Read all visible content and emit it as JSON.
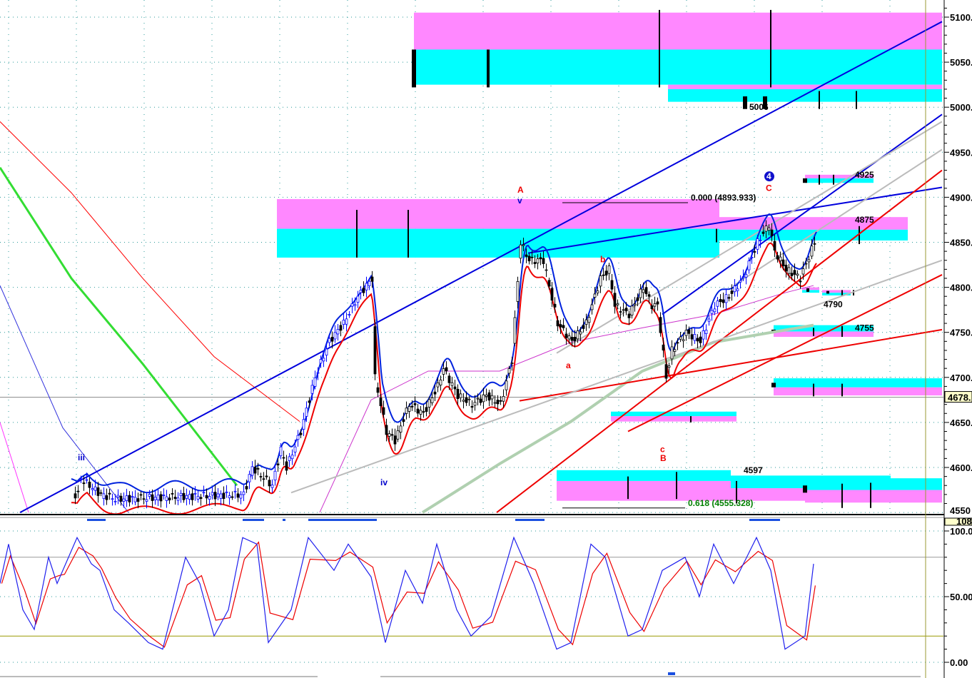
{
  "chart_data": {
    "type": "candlestick",
    "price_axis": {
      "ticks": [
        5100,
        5050,
        5000,
        4950,
        4900,
        4850,
        4800,
        4750,
        4700,
        4650,
        4600
      ],
      "tick_labels": [
        "5100.",
        "5050.",
        "5000.",
        "4950.",
        "4900.",
        "4850.",
        "4800.",
        "4750.",
        "4700.",
        "4650.",
        "4600."
      ],
      "partial_label": "4550",
      "current_price_label": "4678.",
      "current_price": 4678
    },
    "price_path": [
      [
        27,
        4590
      ],
      [
        35,
        4570
      ],
      [
        40,
        4565
      ],
      [
        85,
        4570
      ],
      [
        88,
        4600
      ],
      [
        95,
        4580
      ],
      [
        98,
        4620
      ],
      [
        100,
        4600
      ],
      [
        105,
        4640
      ],
      [
        110,
        4700
      ],
      [
        115,
        4740
      ],
      [
        120,
        4760
      ],
      [
        125,
        4790
      ],
      [
        130,
        4810
      ],
      [
        131,
        4700
      ],
      [
        135,
        4640
      ],
      [
        138,
        4630
      ],
      [
        143,
        4670
      ],
      [
        148,
        4660
      ],
      [
        153,
        4690
      ],
      [
        155,
        4710
      ],
      [
        160,
        4680
      ],
      [
        165,
        4670
      ],
      [
        170,
        4680
      ],
      [
        175,
        4670
      ],
      [
        179,
        4720
      ],
      [
        182,
        4850
      ],
      [
        185,
        4830
      ],
      [
        190,
        4830
      ],
      [
        195,
        4760
      ],
      [
        200,
        4740
      ],
      [
        205,
        4760
      ],
      [
        210,
        4810
      ],
      [
        213,
        4820
      ],
      [
        215,
        4780
      ],
      [
        220,
        4770
      ],
      [
        225,
        4800
      ],
      [
        228,
        4780
      ],
      [
        230,
        4780
      ],
      [
        233,
        4700
      ],
      [
        235,
        4730
      ],
      [
        240,
        4750
      ],
      [
        245,
        4740
      ],
      [
        250,
        4780
      ],
      [
        255,
        4790
      ],
      [
        260,
        4810
      ],
      [
        265,
        4850
      ],
      [
        269,
        4870
      ],
      [
        271,
        4840
      ],
      [
        275,
        4820
      ],
      [
        280,
        4810
      ],
      [
        285,
        4850
      ]
    ],
    "moving_averages": [
      {
        "name": "red-ma",
        "color": "#ff0000",
        "points": [
          [
            0,
            4984
          ],
          [
            25,
            4905
          ],
          [
            50,
            4810
          ],
          [
            75,
            4723
          ],
          [
            105,
            4651
          ]
        ]
      },
      {
        "name": "green-ma",
        "color": "#33dd33",
        "points": [
          [
            0,
            4933
          ],
          [
            25,
            4810
          ],
          [
            50,
            4715
          ],
          [
            83,
            4580
          ]
        ]
      },
      {
        "name": "blue-thin-ma",
        "color": "#3333dd",
        "points": [
          [
            0,
            4802
          ],
          [
            22,
            4644
          ],
          [
            45,
            4550
          ]
        ]
      },
      {
        "name": "magenta-left-ma",
        "color": "#ff33ff",
        "points": [
          [
            0,
            4650
          ],
          [
            10,
            4550
          ]
        ]
      },
      {
        "name": "gray-green-ma",
        "color": "#b0d0b0",
        "points": [
          [
            148,
            4550
          ],
          [
            175,
            4604
          ],
          [
            200,
            4651
          ],
          [
            225,
            4707
          ],
          [
            250,
            4739
          ],
          [
            285,
            4758
          ]
        ]
      },
      {
        "name": "magenta-ma",
        "color": "#cc33cc",
        "points": [
          [
            112,
            4550
          ],
          [
            130,
            4675
          ],
          [
            150,
            4707
          ],
          [
            175,
            4707
          ],
          [
            200,
            4739
          ],
          [
            225,
            4755
          ],
          [
            250,
            4770
          ],
          [
            275,
            4794
          ],
          [
            285,
            4802
          ]
        ]
      }
    ],
    "trendlines": [
      {
        "color": "#0000dd",
        "from": [
          7,
          4550
        ],
        "to": [
          330,
          5095
        ]
      },
      {
        "color": "#0000dd",
        "from": [
          185,
          4838
        ],
        "to": [
          330,
          4911
        ]
      },
      {
        "color": "#0000dd",
        "from": [
          232,
          4770
        ],
        "to": [
          330,
          4992
        ]
      },
      {
        "color": "#ee0000",
        "from": [
          174,
          4550
        ],
        "to": [
          330,
          4930
        ]
      },
      {
        "color": "#ee0000",
        "from": [
          182,
          4674
        ],
        "to": [
          330,
          4753
        ]
      },
      {
        "color": "#ee0000",
        "from": [
          220,
          4640
        ],
        "to": [
          330,
          4814
        ]
      },
      {
        "color": "#bbbbbb",
        "from": [
          102,
          4572
        ],
        "to": [
          330,
          4830
        ]
      },
      {
        "color": "#bbbbbb",
        "from": [
          195,
          4727
        ],
        "to": [
          330,
          4984
        ]
      },
      {
        "color": "#bbbbbb",
        "from": [
          257,
          4802
        ],
        "to": [
          330,
          4953
        ]
      }
    ],
    "zones": [
      {
        "from": 145,
        "to": 330,
        "pink": [
          5105,
          5064
        ],
        "cyan": [
          5064,
          5025
        ]
      },
      {
        "from": 234,
        "to": 330,
        "pink": [
          5025,
          5020
        ],
        "cyan": [
          5020,
          5006
        ]
      },
      {
        "from": 97,
        "to": 252,
        "pink": [
          4898,
          4865
        ],
        "cyan": [
          4865,
          4833
        ]
      },
      {
        "from": 252,
        "to": 318,
        "pink": [
          4878,
          4864
        ],
        "cyan": [
          4864,
          4852
        ]
      },
      {
        "from": 282,
        "to": 306,
        "pink": [
          4925,
          4921
        ],
        "cyan": [
          4921,
          4916
        ]
      },
      {
        "from": 281,
        "to": 287,
        "pink": [
          4800,
          4797
        ],
        "cyan": [
          4797,
          4794
        ]
      },
      {
        "from": 288,
        "to": 298,
        "pink": [
          4797,
          4794
        ],
        "cyan": [
          4794,
          4791
        ]
      },
      {
        "from": 271,
        "to": 306,
        "cyan": [
          4758,
          4751
        ],
        "pink": [
          4751,
          4745
        ]
      },
      {
        "from": 271,
        "to": 330,
        "cyan": [
          4699,
          4689
        ],
        "pink": [
          4689,
          4680
        ]
      },
      {
        "from": 214,
        "to": 258,
        "cyan": [
          4662,
          4657
        ],
        "pink": [
          4657,
          4651
        ]
      },
      {
        "from": 195,
        "to": 256,
        "cyan": [
          4597,
          4585
        ],
        "pink": [
          4585,
          4563
        ]
      },
      {
        "from": 256,
        "to": 312,
        "cyan": [
          4591,
          4577
        ],
        "pink": [
          4577,
          4563
        ]
      },
      {
        "from": 282,
        "to": 330,
        "cyan": [
          4588,
          4575
        ],
        "pink": [
          4575,
          4561
        ]
      }
    ],
    "zone_ticks": [
      [
        145,
        5064,
        5022,
        6
      ],
      [
        171,
        5064,
        5022,
        4
      ],
      [
        231,
        5108,
        5022,
        2
      ],
      [
        270,
        5108,
        5022,
        2
      ],
      [
        125,
        4886,
        4833,
        2
      ],
      [
        143,
        4886,
        4833,
        2
      ],
      [
        261,
        5012,
        4998,
        6
      ],
      [
        268,
        5012,
        4998,
        6
      ],
      [
        287,
        5018,
        4998,
        2
      ],
      [
        300,
        5018,
        4998,
        2
      ],
      [
        251,
        4865,
        4850,
        2
      ],
      [
        301,
        4868,
        4848,
        2
      ],
      [
        282,
        4921,
        4916,
        6
      ],
      [
        287,
        4925,
        4914,
        2
      ],
      [
        292,
        4925,
        4914,
        2
      ],
      [
        283,
        4799,
        4795,
        4
      ],
      [
        290,
        4796,
        4793,
        4
      ],
      [
        295,
        4797,
        4791,
        2
      ],
      [
        299,
        4797,
        4791,
        2
      ],
      [
        271,
        4753,
        4751,
        6
      ],
      [
        285,
        4755,
        4746,
        2
      ],
      [
        295,
        4757,
        4745,
        2
      ],
      [
        271,
        4694,
        4689,
        6
      ],
      [
        285,
        4693,
        4679,
        2
      ],
      [
        295,
        4693,
        4679,
        2
      ],
      [
        242,
        4657,
        4650,
        2
      ],
      [
        220,
        4590,
        4565,
        2
      ],
      [
        237,
        4595,
        4565,
        2
      ],
      [
        258,
        4585,
        4560,
        2
      ],
      [
        282,
        4580,
        4572,
        6
      ],
      [
        295,
        4582,
        4555,
        2
      ],
      [
        305,
        4583,
        4555,
        2
      ]
    ],
    "fib_lines": [
      {
        "label": "0.000 (4893.933)",
        "price": 4894,
        "from": 197,
        "to": 241,
        "color": "#000000"
      },
      {
        "label": "0.618 (4555.328)",
        "price": 4555,
        "from": 197,
        "to": 240,
        "color": "#008000"
      }
    ],
    "level_labels": [
      {
        "text": "5006",
        "bar": 264,
        "price": 5000
      },
      {
        "text": "4925",
        "bar": 301,
        "price": 4925
      },
      {
        "text": "4875",
        "bar": 301,
        "price": 4875
      },
      {
        "text": "4790",
        "bar": 290,
        "price": 4781
      },
      {
        "text": "4755",
        "bar": 301,
        "price": 4755
      },
      {
        "text": "4597",
        "bar": 262,
        "price": 4597
      }
    ],
    "wave_labels": [
      {
        "text": "A",
        "bar": 182,
        "price": 4905,
        "color": "#ee0000"
      },
      {
        "text": "v",
        "bar": 182,
        "price": 4893,
        "color": "#0000cc"
      },
      {
        "text": "C",
        "bar": 269,
        "price": 4907,
        "color": "#ee0000"
      },
      {
        "text": "4",
        "bar": 269,
        "price": 4920,
        "color": "#0000cc",
        "circle": true
      },
      {
        "text": "b",
        "bar": 211,
        "price": 4828,
        "color": "#ee0000"
      },
      {
        "text": "a",
        "bar": 199,
        "price": 4710,
        "color": "#ee0000"
      },
      {
        "text": "c",
        "bar": 232,
        "price": 4617,
        "color": "#ee0000"
      },
      {
        "text": "B",
        "bar": 232,
        "price": 4607,
        "color": "#ee0000"
      },
      {
        "text": "iii",
        "bar": 28,
        "price": 4608,
        "color": "#0000cc"
      },
      {
        "text": "iv",
        "bar": 134,
        "price": 4580,
        "color": "#0000cc"
      }
    ],
    "oscillator": {
      "ticks": [
        100,
        50,
        0
      ],
      "tick_labels": [
        "100.0",
        "50.00",
        "0.00"
      ],
      "top_tag": "108.",
      "levels": [
        80,
        20
      ],
      "k": [
        [
          0,
          60
        ],
        [
          3,
          90
        ],
        [
          8,
          40
        ],
        [
          12,
          25
        ],
        [
          17,
          80
        ],
        [
          20,
          60
        ],
        [
          22,
          70
        ],
        [
          27,
          95
        ],
        [
          32,
          75
        ],
        [
          35,
          70
        ],
        [
          40,
          40
        ],
        [
          45,
          30
        ],
        [
          52,
          15
        ],
        [
          57,
          10
        ],
        [
          65,
          80
        ],
        [
          70,
          60
        ],
        [
          75,
          20
        ],
        [
          80,
          40
        ],
        [
          85,
          95
        ],
        [
          90,
          90
        ],
        [
          94,
          15
        ],
        [
          102,
          40
        ],
        [
          108,
          95
        ],
        [
          117,
          70
        ],
        [
          122,
          90
        ],
        [
          130,
          65
        ],
        [
          135,
          15
        ],
        [
          142,
          70
        ],
        [
          148,
          45
        ],
        [
          153,
          90
        ],
        [
          160,
          40
        ],
        [
          165,
          20
        ],
        [
          172,
          35
        ],
        [
          180,
          95
        ],
        [
          187,
          60
        ],
        [
          195,
          10
        ],
        [
          200,
          15
        ],
        [
          207,
          90
        ],
        [
          212,
          80
        ],
        [
          220,
          20
        ],
        [
          225,
          25
        ],
        [
          232,
          70
        ],
        [
          240,
          80
        ],
        [
          245,
          50
        ],
        [
          250,
          90
        ],
        [
          257,
          60
        ],
        [
          265,
          95
        ],
        [
          270,
          70
        ],
        [
          275,
          10
        ],
        [
          282,
          20
        ],
        [
          285,
          75
        ]
      ]
    }
  }
}
